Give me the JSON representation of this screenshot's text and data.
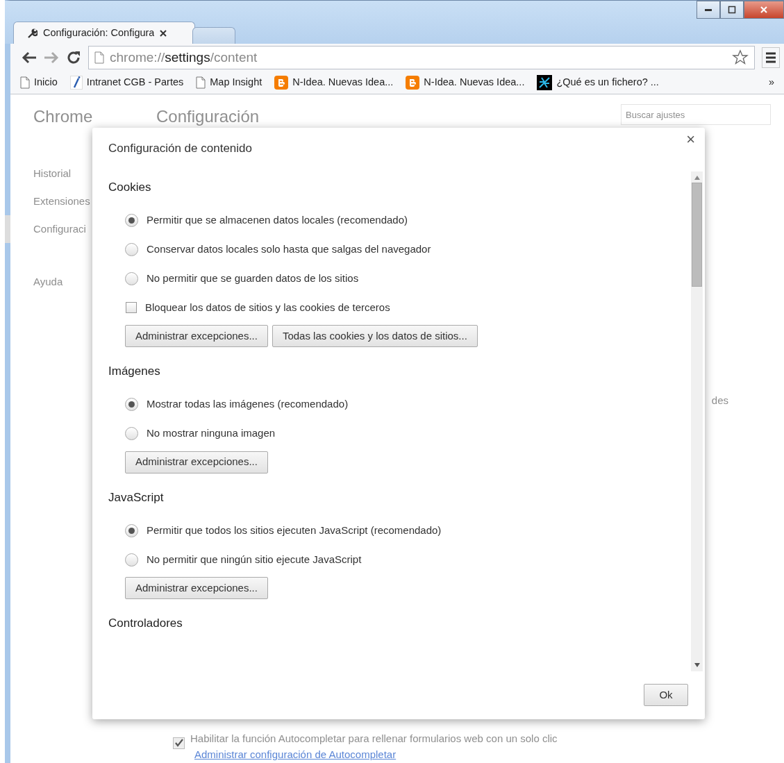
{
  "tabs": [
    {
      "title": "Configuración: Configura",
      "selected": true
    },
    {
      "selected": false
    }
  ],
  "toolbar": {
    "url": {
      "scheme": "chrome://",
      "host": "settings",
      "path": "/content"
    }
  },
  "bookmarks": {
    "items": [
      {
        "label": "Inicio",
        "kind": "page"
      },
      {
        "label": "Intranet CGB - Partes",
        "kind": "italic"
      },
      {
        "label": "Map Insight",
        "kind": "page"
      },
      {
        "label": "N-Idea. Nuevas Idea...",
        "kind": "blogger"
      },
      {
        "label": "N-Idea. Nuevas Idea...",
        "kind": "blogger"
      },
      {
        "label": "¿Qué es un fichero? ...",
        "kind": "site"
      }
    ],
    "overflow": "»"
  },
  "background_page": {
    "brand": "Chrome",
    "title": "Configuración",
    "search": {
      "placeholder": "Buscar ajustes"
    },
    "sidebar": {
      "items": [
        {
          "label": "Historial",
          "selected": false
        },
        {
          "label": "Extensiones",
          "selected": false
        },
        {
          "label": "Configuraci",
          "selected": true
        },
        {
          "label": "Ayuda",
          "selected": false
        }
      ]
    },
    "fragment": "des",
    "autofill": {
      "label": "Habilitar la función Autocompletar para rellenar formularios web con un solo clic",
      "checked": true,
      "link": "Administrar configuración de Autocompletar"
    }
  },
  "dialog": {
    "title": "Configuración de contenido",
    "close": "×",
    "sections": [
      {
        "heading": "Cookies",
        "options": [
          {
            "kind": "radio",
            "label": "Permitir que se almacenen datos locales (recomendado)",
            "selected": true
          },
          {
            "kind": "radio",
            "label": "Conservar datos locales solo hasta que salgas del navegador",
            "selected": false
          },
          {
            "kind": "radio",
            "label": "No permitir que se guarden datos de los sitios",
            "selected": false
          },
          {
            "kind": "checkbox",
            "label": "Bloquear los datos de sitios y las cookies de terceros",
            "checked": false
          }
        ],
        "buttons": [
          "Administrar excepciones...",
          "Todas las cookies y los datos de sitios..."
        ]
      },
      {
        "heading": "Imágenes",
        "options": [
          {
            "kind": "radio",
            "label": "Mostrar todas las imágenes (recomendado)",
            "selected": true
          },
          {
            "kind": "radio",
            "label": "No mostrar ninguna imagen",
            "selected": false
          }
        ],
        "buttons": [
          "Administrar excepciones..."
        ]
      },
      {
        "heading": "JavaScript",
        "options": [
          {
            "kind": "radio",
            "label": "Permitir que todos los sitios ejecuten JavaScript (recomendado)",
            "selected": true
          },
          {
            "kind": "radio",
            "label": "No permitir que ningún sitio ejecute JavaScript",
            "selected": false
          }
        ],
        "buttons": [
          "Administrar excepciones..."
        ]
      },
      {
        "heading": "Controladores"
      }
    ],
    "ok": "Ok"
  }
}
